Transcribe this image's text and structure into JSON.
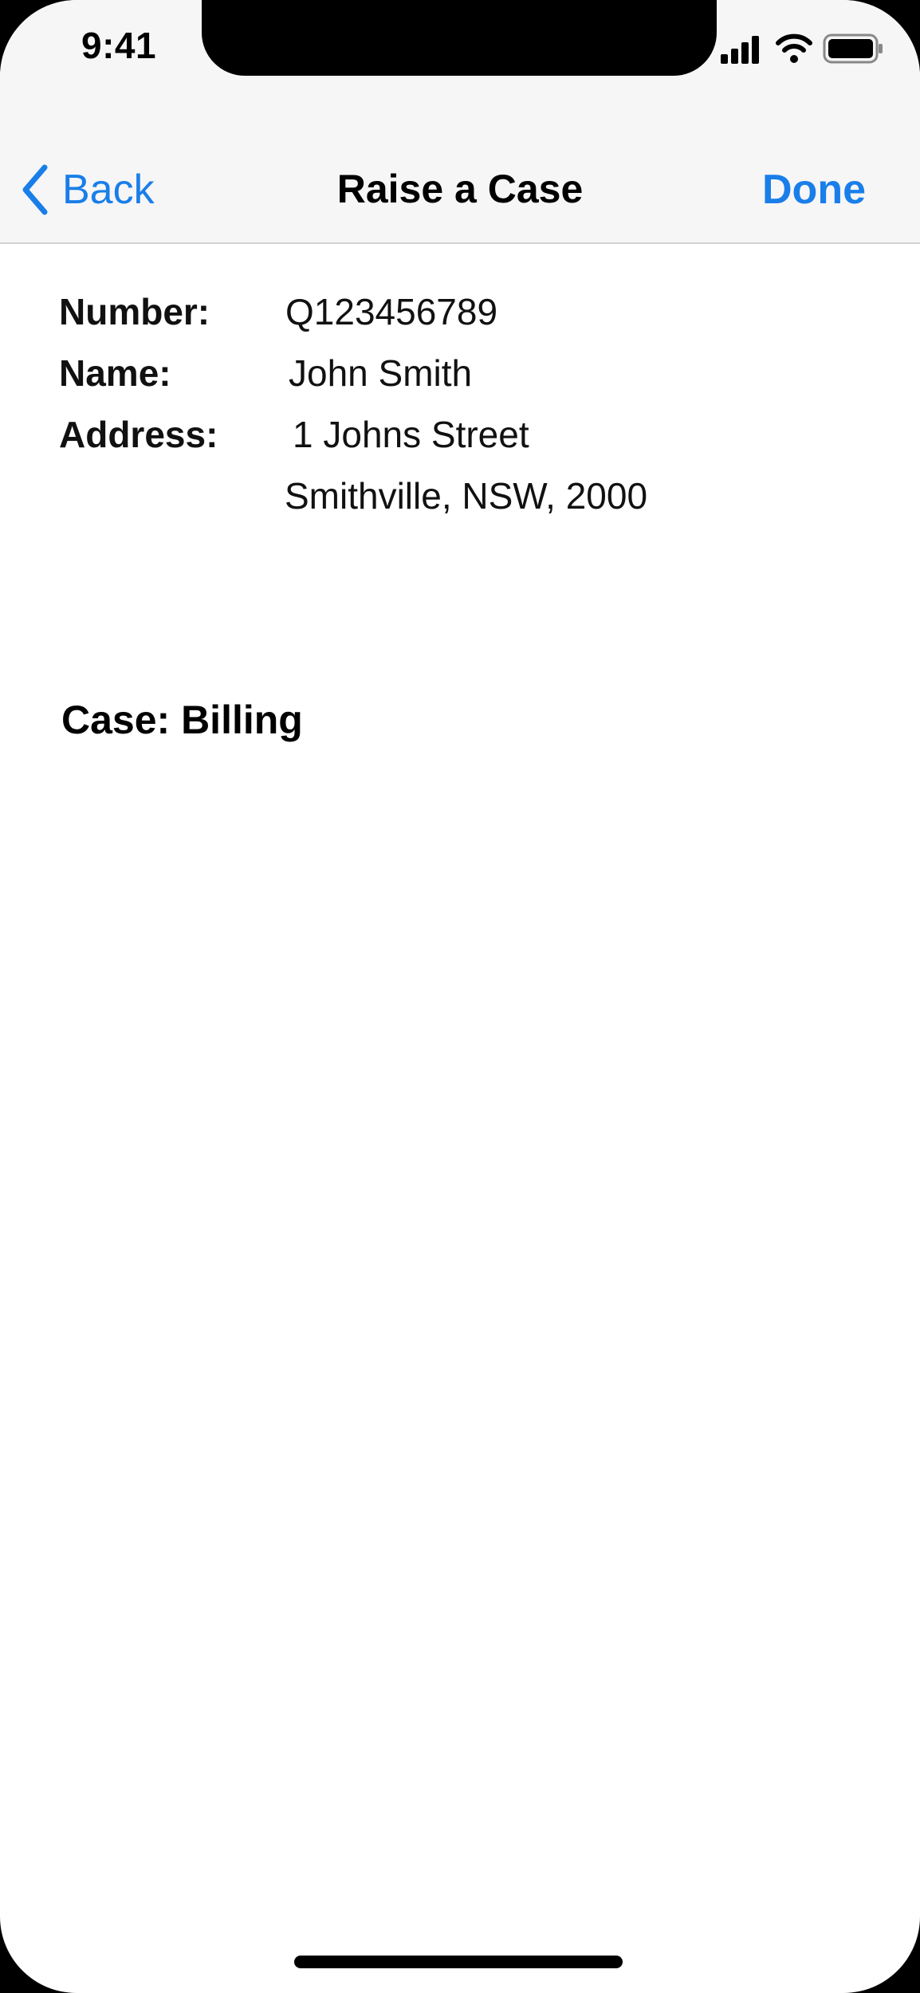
{
  "status_bar": {
    "time": "9:41",
    "icons": [
      "cellular-signal-icon",
      "wifi-icon",
      "battery-icon"
    ]
  },
  "nav": {
    "back_label": "Back",
    "back_icon": "chevron-left-icon",
    "title": "Raise a Case",
    "done_label": "Done"
  },
  "customer": {
    "number_label": "Number:",
    "number_value": "Q123456789",
    "name_label": "Name:",
    "name_value": "John Smith",
    "address_label": "Address:",
    "address_line1": "1 Johns Street",
    "address_line2": "Smithville, NSW, 2000"
  },
  "case": {
    "heading": "Case: Billing"
  },
  "colors": {
    "accent": "#1a7ee9",
    "nav_background": "#f6f6f6",
    "text": "#111111"
  }
}
